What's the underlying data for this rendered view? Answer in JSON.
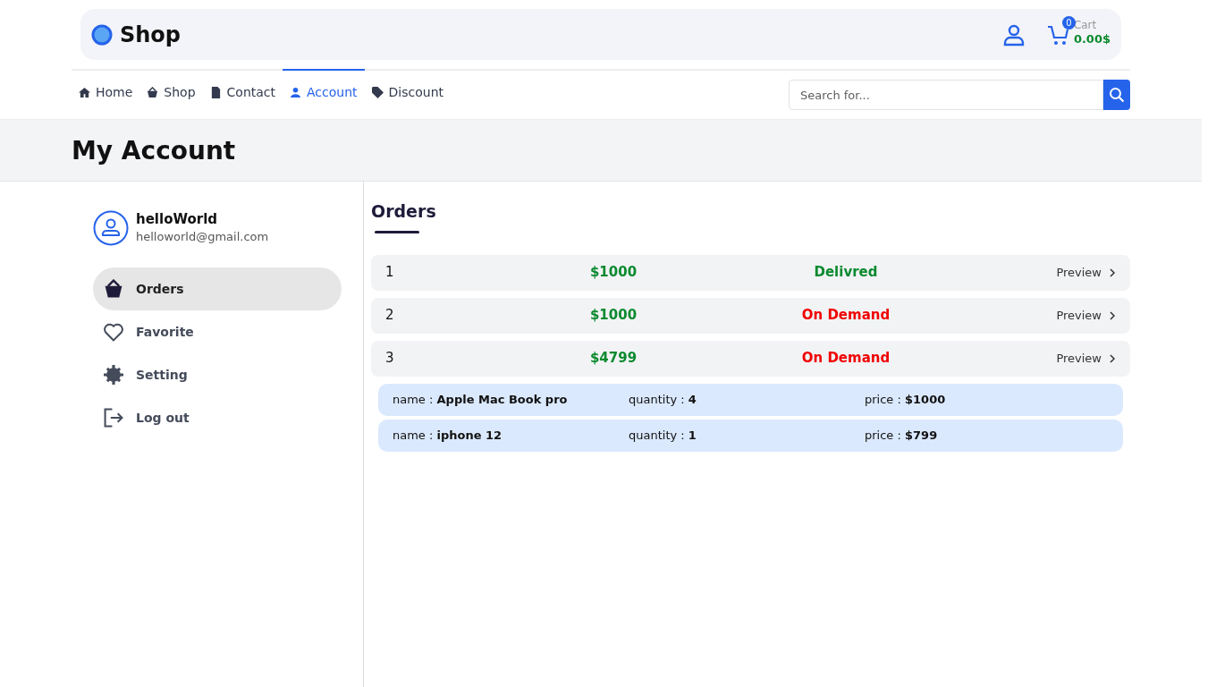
{
  "brand": {
    "name": "Shop"
  },
  "cart": {
    "count": "0",
    "label": "Cart",
    "total": "0.00$"
  },
  "nav": [
    {
      "label": "Home",
      "kind": "home",
      "selected": false
    },
    {
      "label": "Shop",
      "kind": "basket",
      "selected": false
    },
    {
      "label": "Contact",
      "kind": "doc",
      "selected": false
    },
    {
      "label": "Account",
      "kind": "user",
      "selected": true
    },
    {
      "label": "Discount",
      "kind": "tag",
      "selected": false
    }
  ],
  "search": {
    "placeholder": "Search for..."
  },
  "page_title": "My Account",
  "user": {
    "name": "helloWorld",
    "email": "helloworld@gmail.com"
  },
  "sidebar": {
    "items": [
      {
        "label": "Orders",
        "kind": "basket",
        "selected": true
      },
      {
        "label": "Favorite",
        "kind": "heart",
        "selected": false
      },
      {
        "label": "Setting",
        "kind": "gear",
        "selected": false
      },
      {
        "label": "Log out",
        "kind": "logout",
        "selected": false
      }
    ]
  },
  "orders": {
    "title": "Orders",
    "rows": [
      {
        "number": "1",
        "amount": "$1000",
        "status": "Delivred",
        "delivered": true,
        "action": "Preview"
      },
      {
        "number": "2",
        "amount": "$1000",
        "status": "On Demand",
        "delivered": false,
        "action": "Preview"
      },
      {
        "number": "3",
        "amount": "$4799",
        "status": "On Demand",
        "delivered": false,
        "action": "Preview",
        "items": [
          {
            "name": "name : **Apple Mac Book pro**",
            "quantity": "quantity : **4**",
            "price": "price : **$1000**"
          },
          {
            "name": "name : **iphone 12**",
            "quantity": "quantity : **1**",
            "price": "price : **$799**"
          }
        ]
      }
    ]
  }
}
